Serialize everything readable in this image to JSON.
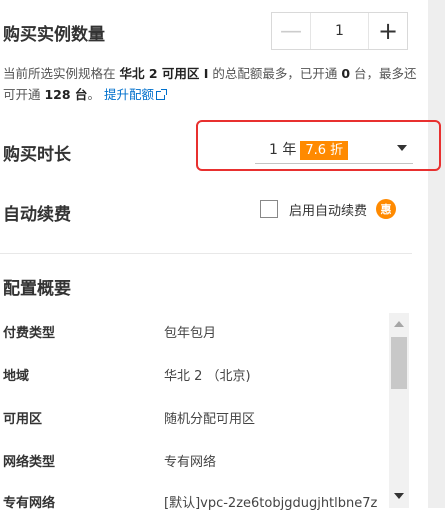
{
  "quantity": {
    "label": "购买实例数量",
    "minus_symbol": "—",
    "plus_symbol": "+",
    "value": "1"
  },
  "quota": {
    "prefix": "当前所选实例规格在 ",
    "region": "华北 2 可用区 I",
    "mid1": " 的总配额最多，已开通 ",
    "opened": "0",
    "mid2": " 台，最多还可开通 ",
    "remaining": "128 台",
    "mid3": "。",
    "link": "提升配额"
  },
  "duration": {
    "label": "购买时长",
    "selected": "1 年",
    "discount": "7.6 折"
  },
  "auto_renew": {
    "label": "自动续费",
    "checkbox_label": "启用自动续费",
    "badge": "惠",
    "checked": false
  },
  "summary": {
    "title": "配置概要",
    "rows": [
      {
        "key": "付费类型",
        "value": "包年包月"
      },
      {
        "key": "地域",
        "value": "华北 2 （北京)"
      },
      {
        "key": "可用区",
        "value": "随机分配可用区"
      },
      {
        "key": "网络类型",
        "value": "专有网络"
      },
      {
        "key": "专有网络",
        "value": "[默认]vpc-2ze6tobjgdugjhtlbne7z"
      }
    ]
  },
  "colors": {
    "accent_red": "#e8302f",
    "discount_orange": "#ff8a00",
    "link_blue": "#0070cc"
  }
}
